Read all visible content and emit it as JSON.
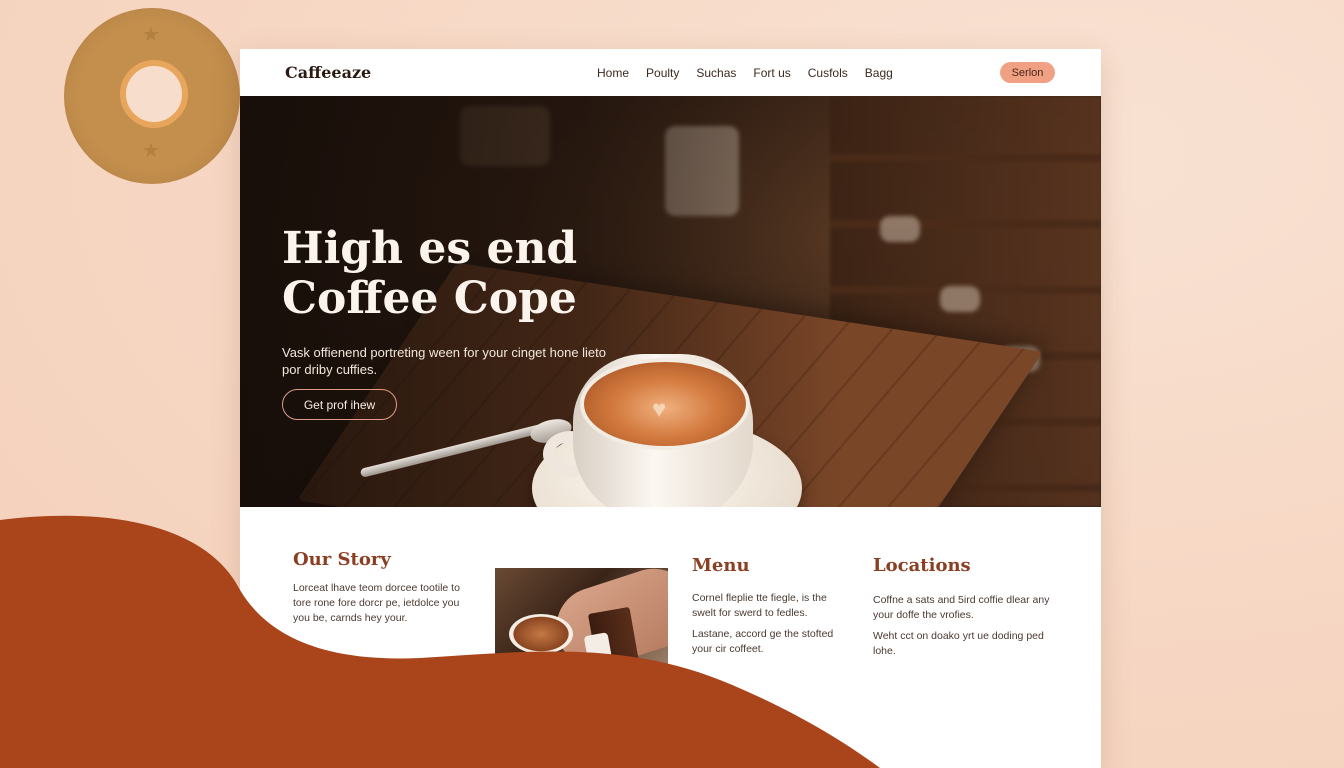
{
  "colors": {
    "background": "#f6d7c4",
    "accent": "#f1a183",
    "heading_brown": "#8a3f22",
    "swoosh": "#a9441b"
  },
  "nav": {
    "brand": "Caffeeaze",
    "links": [
      "Home",
      "Poulty",
      "Suchas",
      "Fort us",
      "Cusfols",
      "Bagg"
    ],
    "cta": "Serlon"
  },
  "hero": {
    "title_line1": "High es end",
    "title_line2": "Coffee Cope",
    "subtitle": "Vask offienend portreting ween for your cinget hone lieto por driby cuffies.",
    "button": "Get prof ihew"
  },
  "sections": {
    "story": {
      "title": "Our Story",
      "body": "Lorceat lhave teom dorcee tootile to tore rone fore dorcr pe, ietdolce you you be, carnds hey your."
    },
    "menu": {
      "title": "Menu",
      "body1": "Cornel fleplie tte fiegle, is the swelt for swerd to fedles.",
      "body2": "Lastane, accord ge the stofted your cir coffeet."
    },
    "locations": {
      "title": "Locations",
      "body1": "Coffne a sats and 5ird coffie dlear any your doffe the vrofies.",
      "body2": "Weht cct on doako yrt ue doding ped lohe."
    }
  },
  "icons": {
    "hero_image": "coffee-cup-photo",
    "story_image": "latte-and-cake-photo",
    "decor": "star-icon"
  }
}
